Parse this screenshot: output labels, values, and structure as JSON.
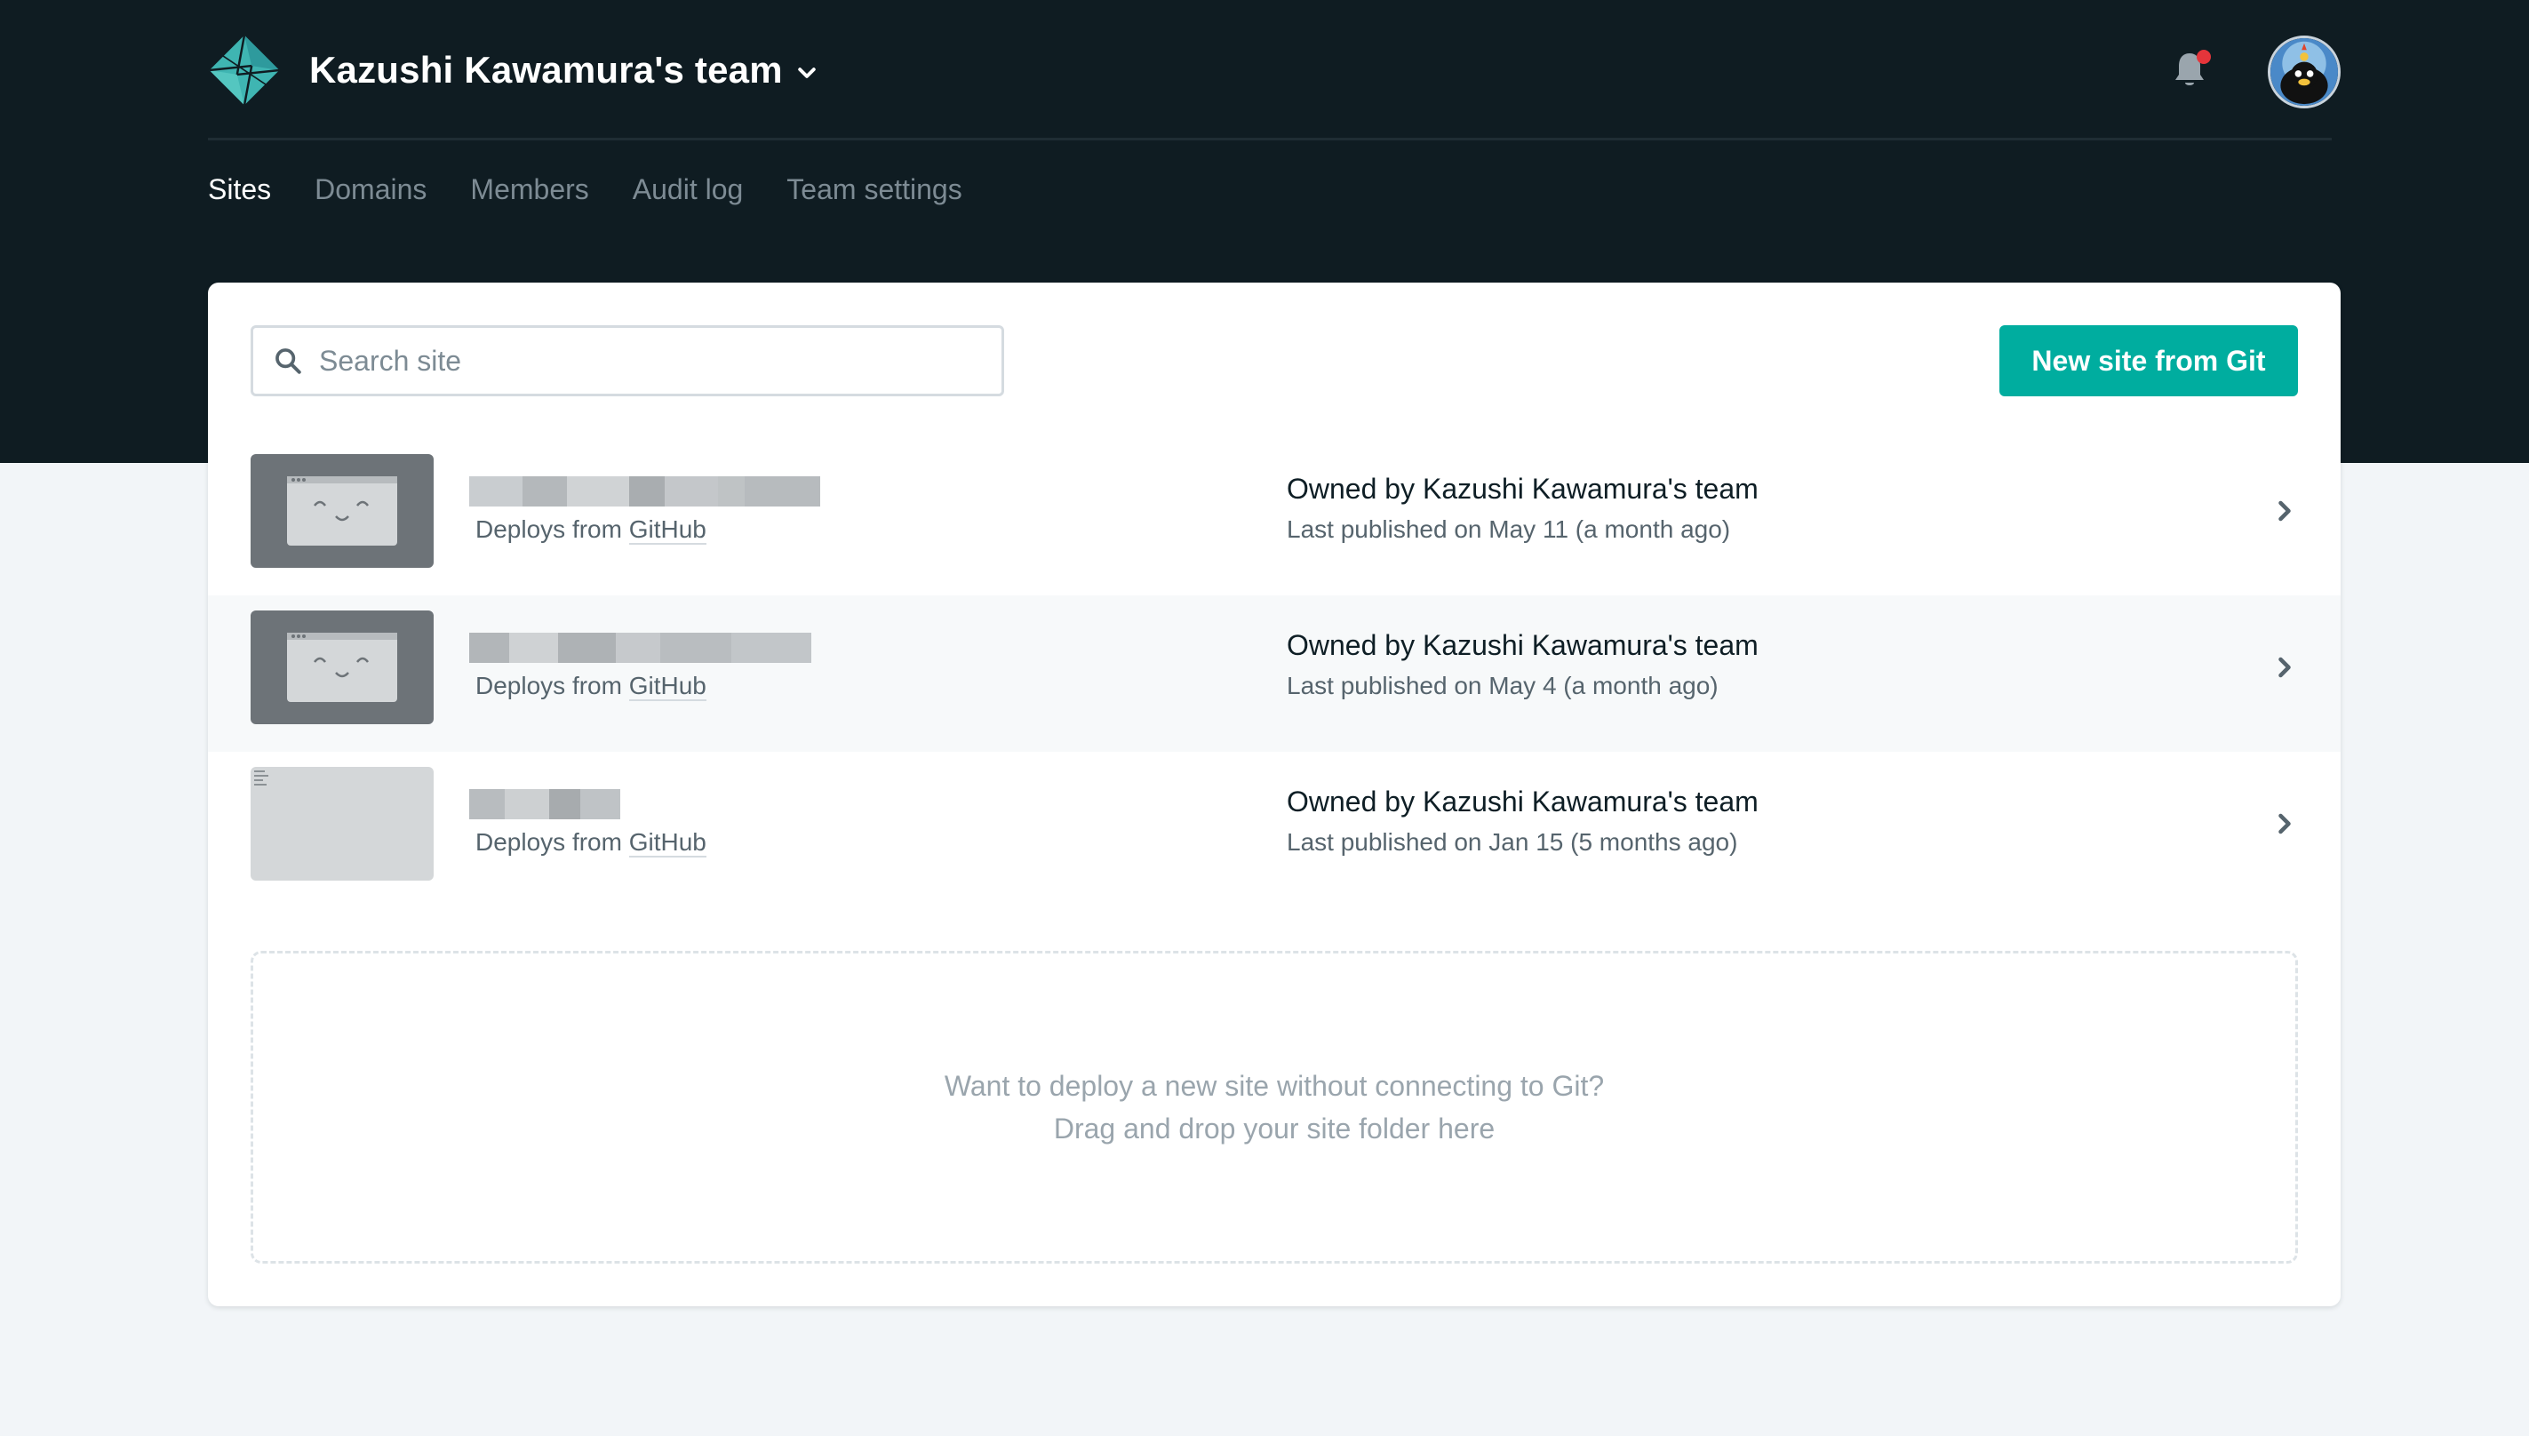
{
  "header": {
    "team_name": "Kazushi Kawamura's team",
    "notification_dot_color": "#e5353b",
    "logo_color": "#3fb5b2"
  },
  "nav": {
    "items": [
      {
        "label": "Sites",
        "active": true
      },
      {
        "label": "Domains",
        "active": false
      },
      {
        "label": "Members",
        "active": false
      },
      {
        "label": "Audit log",
        "active": false
      },
      {
        "label": "Team settings",
        "active": false
      }
    ]
  },
  "search": {
    "placeholder": "Search site",
    "value": ""
  },
  "new_site_button": {
    "label": "New site from Git",
    "color": "#00ad9f"
  },
  "sites": [
    {
      "deploys_prefix": "Deploys from ",
      "deploys_source": "GitHub",
      "owner_prefix": "Owned by ",
      "owner": "Kazushi Kawamura's team",
      "published": "Last published on May 11 (a month ago)"
    },
    {
      "deploys_prefix": "Deploys from ",
      "deploys_source": "GitHub",
      "owner_prefix": "Owned by ",
      "owner": "Kazushi Kawamura's team",
      "published": "Last published on May 4 (a month ago)"
    },
    {
      "deploys_prefix": "Deploys from ",
      "deploys_source": "GitHub",
      "owner_prefix": "Owned by ",
      "owner": "Kazushi Kawamura's team",
      "published": "Last published on Jan 15 (5 months ago)"
    }
  ],
  "dropzone": {
    "line1": "Want to deploy a new site without connecting to Git?",
    "line2": "Drag and drop your site folder here"
  }
}
